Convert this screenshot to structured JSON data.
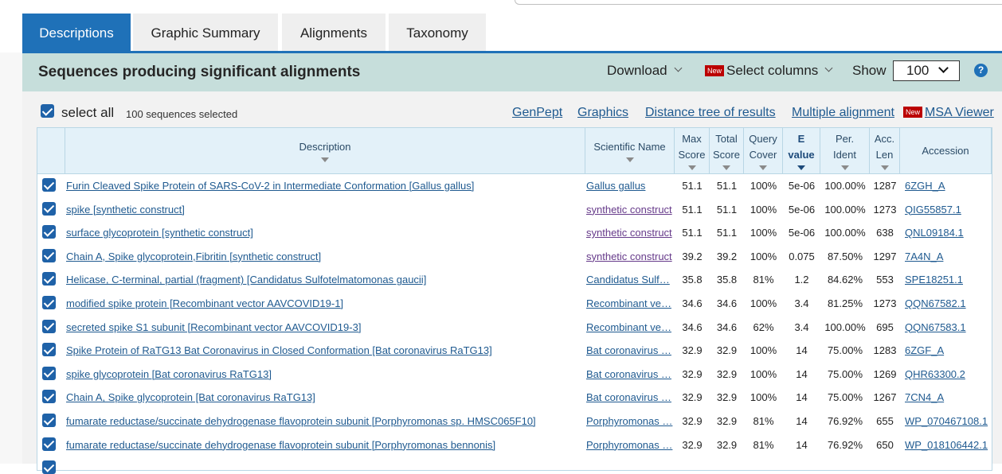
{
  "tabs": [
    "Descriptions",
    "Graphic Summary",
    "Alignments",
    "Taxonomy"
  ],
  "panel": {
    "title": "Sequences producing significant alignments",
    "download": "Download",
    "new_badge": "New",
    "select_columns": "Select columns",
    "show_label": "Show",
    "show_value": "100",
    "help": "?"
  },
  "toolbar": {
    "select_all": "select all",
    "selected_count": "100 sequences selected",
    "links": [
      "GenPept",
      "Graphics",
      "Distance tree of results",
      "Multiple alignment",
      "MSA Viewer"
    ]
  },
  "columns": [
    {
      "l1": "Description",
      "l2": ""
    },
    {
      "l1": "Scientific Name",
      "l2": ""
    },
    {
      "l1": "Max",
      "l2": "Score"
    },
    {
      "l1": "Total",
      "l2": "Score"
    },
    {
      "l1": "Query",
      "l2": "Cover"
    },
    {
      "l1": "E",
      "l2": "value"
    },
    {
      "l1": "Per.",
      "l2": "Ident"
    },
    {
      "l1": "Acc.",
      "l2": "Len"
    },
    {
      "l1": "Accession",
      "l2": ""
    }
  ],
  "rows": [
    {
      "desc": "Furin Cleaved Spike Protein of SARS-CoV-2 in Intermediate Conformation [Gallus gallus]",
      "sci": "Gallus gallus",
      "max": "51.1",
      "total": "51.1",
      "cover": "100%",
      "evalue": "5e-06",
      "ident": "100.00%",
      "len": "1287",
      "acc": "6ZGH_A",
      "visited": false
    },
    {
      "desc": "spike [synthetic construct]",
      "sci": "synthetic construct",
      "max": "51.1",
      "total": "51.1",
      "cover": "100%",
      "evalue": "5e-06",
      "ident": "100.00%",
      "len": "1273",
      "acc": "QIG55857.1",
      "visited": true
    },
    {
      "desc": "surface glycoprotein [synthetic construct]",
      "sci": "synthetic construct",
      "max": "51.1",
      "total": "51.1",
      "cover": "100%",
      "evalue": "5e-06",
      "ident": "100.00%",
      "len": "638",
      "acc": "QNL09184.1",
      "visited": true
    },
    {
      "desc": "Chain A, Spike glycoprotein,Fibritin [synthetic construct]",
      "sci": "synthetic construct",
      "max": "39.2",
      "total": "39.2",
      "cover": "100%",
      "evalue": "0.075",
      "ident": "87.50%",
      "len": "1297",
      "acc": "7A4N_A",
      "visited": true
    },
    {
      "desc": "Helicase, C-terminal, partial (fragment) [Candidatus Sulfotelmatomonas gaucii]",
      "sci": "Candidatus Sulf…",
      "max": "35.8",
      "total": "35.8",
      "cover": "81%",
      "evalue": "1.2",
      "ident": "84.62%",
      "len": "553",
      "acc": "SPE18251.1",
      "visited": false
    },
    {
      "desc": "modified spike protein [Recombinant vector AAVCOVID19-1]",
      "sci": "Recombinant ve…",
      "max": "34.6",
      "total": "34.6",
      "cover": "100%",
      "evalue": "3.4",
      "ident": "81.25%",
      "len": "1273",
      "acc": "QQN67582.1",
      "visited": false
    },
    {
      "desc": "secreted spike S1 subunit [Recombinant vector AAVCOVID19-3]",
      "sci": "Recombinant ve…",
      "max": "34.6",
      "total": "34.6",
      "cover": "62%",
      "evalue": "3.4",
      "ident": "100.00%",
      "len": "695",
      "acc": "QQN67583.1",
      "visited": false
    },
    {
      "desc": "Spike Protein of RaTG13 Bat Coronavirus in Closed Conformation [Bat coronavirus RaTG13]",
      "sci": "Bat coronavirus …",
      "max": "32.9",
      "total": "32.9",
      "cover": "100%",
      "evalue": "14",
      "ident": "75.00%",
      "len": "1283",
      "acc": "6ZGF_A",
      "visited": false
    },
    {
      "desc": "spike glycoprotein [Bat coronavirus RaTG13]",
      "sci": "Bat coronavirus …",
      "max": "32.9",
      "total": "32.9",
      "cover": "100%",
      "evalue": "14",
      "ident": "75.00%",
      "len": "1269",
      "acc": "QHR63300.2",
      "visited": false
    },
    {
      "desc": "Chain A, Spike glycoprotein [Bat coronavirus RaTG13]",
      "sci": "Bat coronavirus …",
      "max": "32.9",
      "total": "32.9",
      "cover": "100%",
      "evalue": "14",
      "ident": "75.00%",
      "len": "1267",
      "acc": "7CN4_A",
      "visited": false
    },
    {
      "desc": "fumarate reductase/succinate dehydrogenase flavoprotein subunit [Porphyromonas sp. HMSC065F10]",
      "sci": "Porphyromonas …",
      "max": "32.9",
      "total": "32.9",
      "cover": "81%",
      "evalue": "14",
      "ident": "76.92%",
      "len": "655",
      "acc": "WP_070467108.1",
      "visited": false
    },
    {
      "desc": "fumarate reductase/succinate dehydrogenase flavoprotein subunit [Porphyromonas bennonis]",
      "sci": "Porphyromonas …",
      "max": "32.9",
      "total": "32.9",
      "cover": "81%",
      "evalue": "14",
      "ident": "76.92%",
      "len": "650",
      "acc": "WP_018106442.1",
      "visited": false
    }
  ]
}
